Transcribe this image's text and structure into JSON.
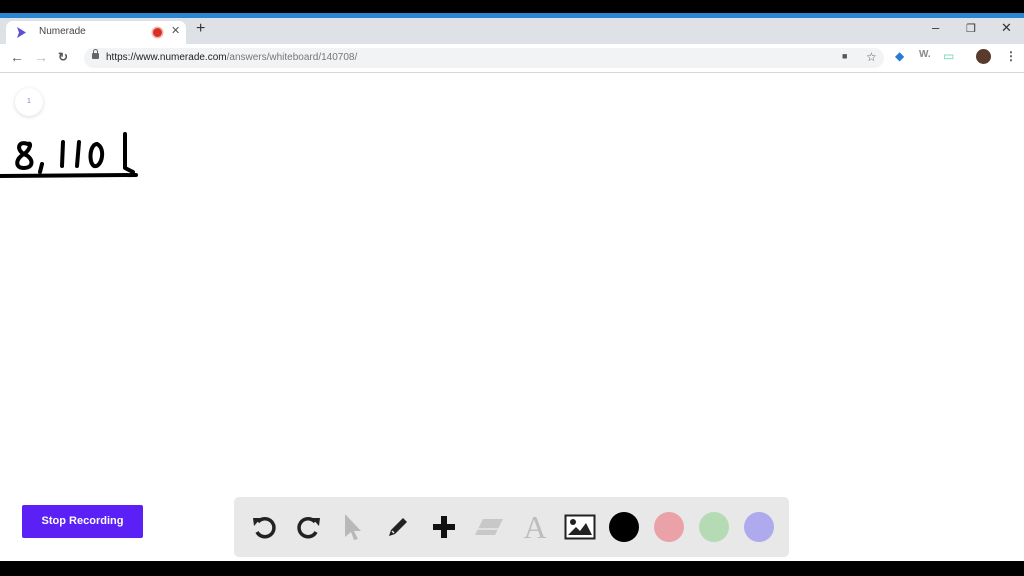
{
  "browser": {
    "tab": {
      "title": "Numerade",
      "recording": true
    },
    "new_tab_label": "+",
    "window_controls": {
      "minimize": "–",
      "restore": "❐",
      "close": "✕"
    },
    "nav": {
      "back": "←",
      "forward": "→",
      "reload": "C"
    },
    "url": {
      "host": "https://www.numerade.com",
      "path": "/answers/whiteboard/140708/"
    },
    "extensions": [
      "video-camera",
      "star",
      "graduation-cap",
      "W.",
      "monitor",
      "profile-avatar",
      "menu"
    ]
  },
  "whiteboard": {
    "page_number": "1",
    "handwriting": "8,110",
    "stop_button_label": "Stop Recording",
    "tools": [
      "undo",
      "redo",
      "select",
      "pencil",
      "add",
      "eraser",
      "text",
      "image"
    ],
    "text_tool_glyph": "A",
    "colors": [
      {
        "name": "black",
        "hex": "#000000",
        "selected": true
      },
      {
        "name": "pink",
        "hex": "#eba1a8"
      },
      {
        "name": "green",
        "hex": "#b4dbb4"
      },
      {
        "name": "purple",
        "hex": "#afa9ee"
      }
    ]
  }
}
